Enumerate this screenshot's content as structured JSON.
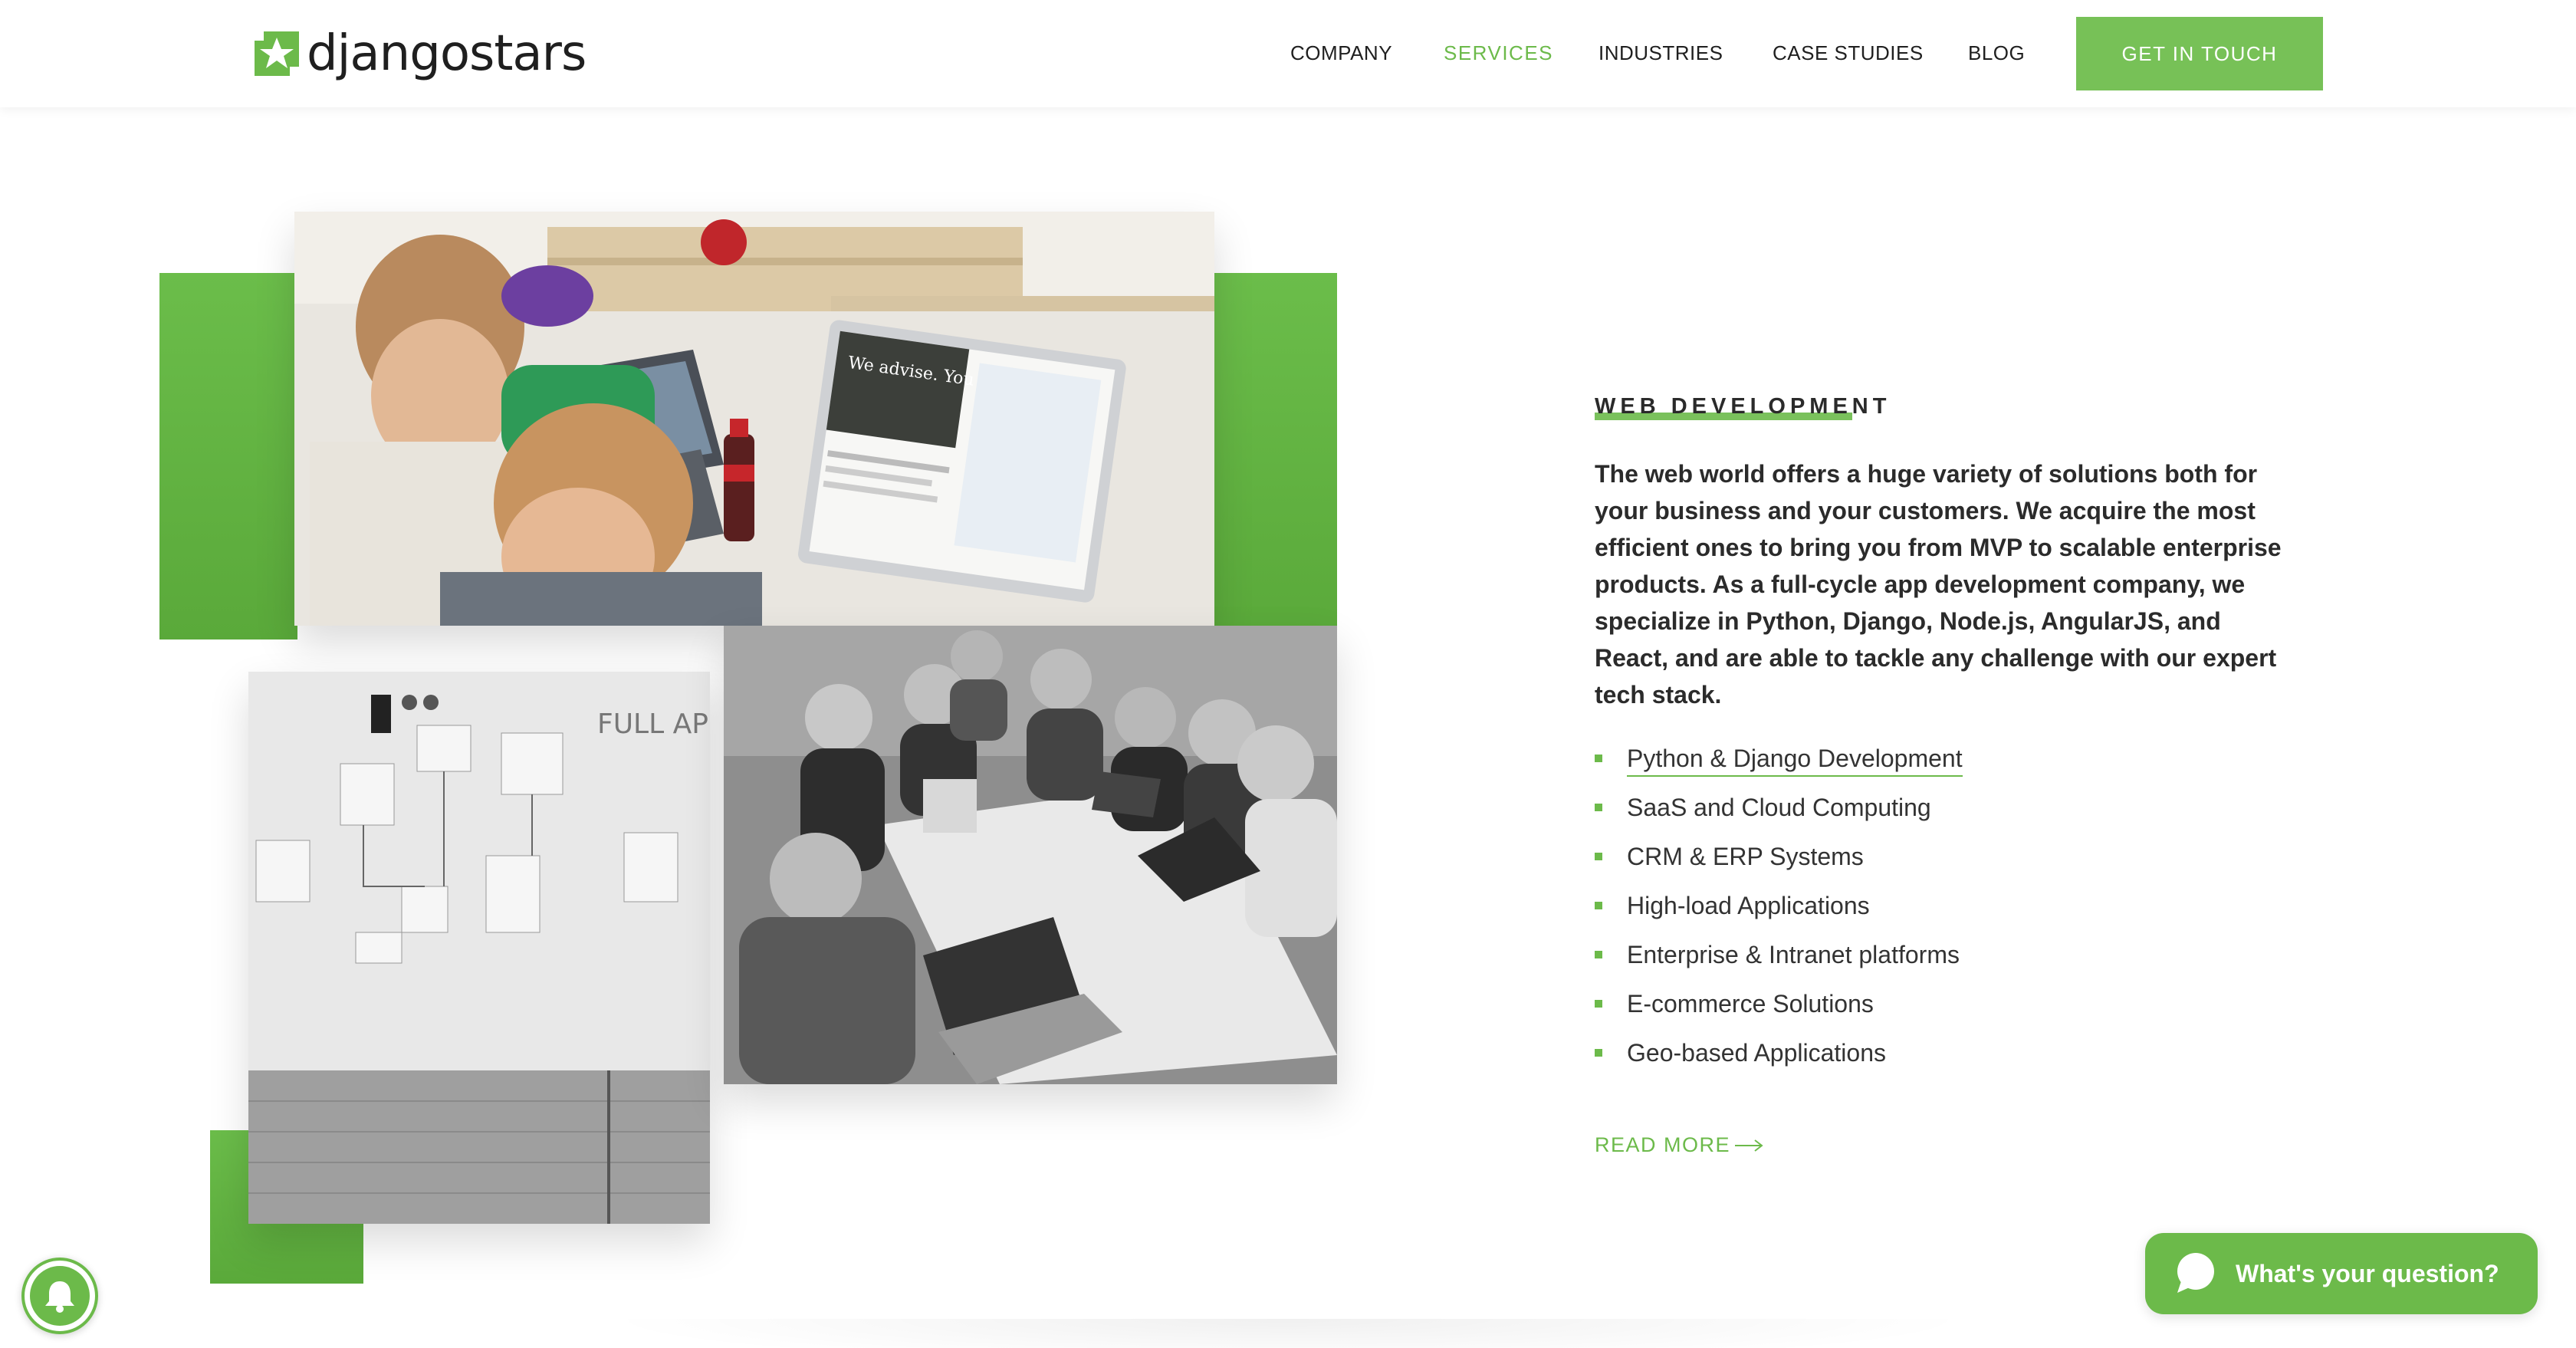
{
  "brand": {
    "name": "djangostars",
    "accent_color": "#6cba4a"
  },
  "nav": {
    "items": [
      "COMPANY",
      "SERVICES",
      "INDUSTRIES",
      "CASE STUDIES",
      "BLOG"
    ],
    "active": "SERVICES",
    "cta_label": "GET IN TOUCH"
  },
  "section": {
    "title": "WEB DEVELOPMENT",
    "description": "The web world offers a huge variety of solutions both for your business and your customers. We acquire the most efficient ones to bring you from MVP to scalable enterprise products. As a full-cycle app development company, we specialize in Python, Django, Node.js, AngularJS, and React, and are able to tackle any challenge with our expert tech stack.",
    "services": [
      "Python & Django Development",
      "SaaS and Cloud Computing",
      "CRM & ERP Systems",
      "High-load Applications",
      "Enterprise & Intranet platforms",
      "E-commerce Solutions",
      "Geo-based Applications"
    ],
    "read_more_label": "READ MORE"
  },
  "collage": {
    "photos": [
      "office-team-at-computers-photo",
      "whiteboard-with-notes-photo",
      "team-meeting-table-photo"
    ],
    "whiteboard_text": "FULL APPLIC",
    "monitor_text": "We advise. You decide."
  },
  "chat": {
    "label": "What's your question?"
  },
  "icons": {
    "logo": "djangostars-logo-icon",
    "arrow": "arrow-right-icon",
    "chat": "chat-bubble-icon",
    "bell": "notification-bell-icon"
  }
}
